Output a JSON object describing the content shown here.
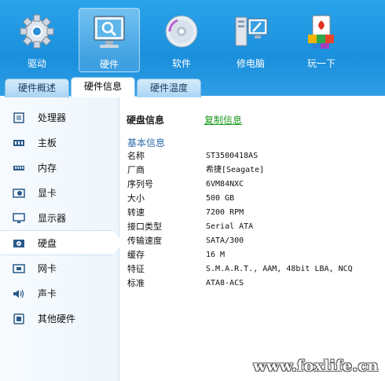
{
  "toolbar": {
    "items": [
      {
        "label": "驱动",
        "icon": "gear-icon"
      },
      {
        "label": "硬件",
        "icon": "monitor-search-icon"
      },
      {
        "label": "软件",
        "icon": "disc-icon"
      },
      {
        "label": "修电脑",
        "icon": "repair-pc-icon"
      },
      {
        "label": "玩一下",
        "icon": "cards-game-icon"
      }
    ],
    "active": "硬件"
  },
  "tabs": [
    {
      "label": "硬件概述"
    },
    {
      "label": "硬件信息"
    },
    {
      "label": "硬件温度"
    }
  ],
  "active_tab": "硬件信息",
  "sidebar": {
    "items": [
      {
        "label": "处理器",
        "icon": "cpu-icon"
      },
      {
        "label": "主板",
        "icon": "motherboard-icon"
      },
      {
        "label": "内存",
        "icon": "memory-icon"
      },
      {
        "label": "显卡",
        "icon": "graphics-card-icon"
      },
      {
        "label": "显示器",
        "icon": "display-icon"
      },
      {
        "label": "硬盘",
        "icon": "hard-disk-icon"
      },
      {
        "label": "网卡",
        "icon": "network-card-icon"
      },
      {
        "label": "声卡",
        "icon": "speaker-icon"
      },
      {
        "label": "其他硬件",
        "icon": "other-hardware-icon"
      }
    ],
    "active": "硬盘"
  },
  "main": {
    "section_title": "硬盘信息",
    "copy_link": "复制信息",
    "basic_title": "基本信息",
    "rows": [
      {
        "key": "名称",
        "value": "ST3500418AS"
      },
      {
        "key": "厂商",
        "value": "希捷[Seagate]"
      },
      {
        "key": "序列号",
        "value": "6VM84NXC"
      },
      {
        "key": "大小",
        "value": "500 GB"
      },
      {
        "key": "转速",
        "value": "7200 RPM"
      },
      {
        "key": "接口类型",
        "value": "Serial ATA"
      },
      {
        "key": "传输速度",
        "value": "SATA/300"
      },
      {
        "key": "缓存",
        "value": "16 M"
      },
      {
        "key": "特征",
        "value": "S.M.A.R.T., AAM, 48bit LBA, NCQ"
      },
      {
        "key": "标准",
        "value": "ATA8-ACS"
      }
    ]
  },
  "watermark": "www.foxlife.cn",
  "colors": {
    "toolbar_blue": "#1b8fdc",
    "link_green": "#1a9a1a",
    "section_blue": "#2a6aa8"
  }
}
